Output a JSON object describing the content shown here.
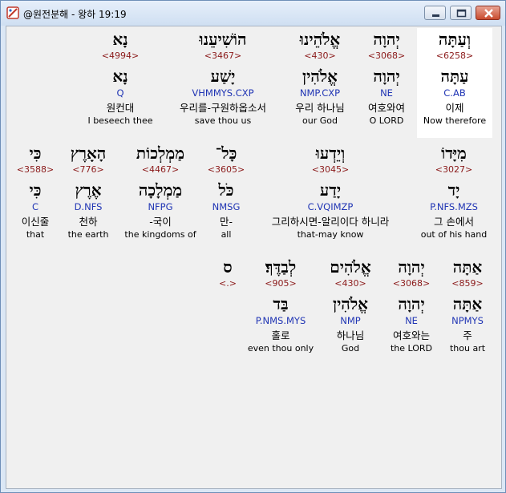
{
  "window": {
    "title": "@원전분해 - 왕하 19:19"
  },
  "rows": [
    [
      {
        "heb": "וְעַתָּה",
        "strong": "<6258>",
        "lemma": "עַתָּה",
        "morph": "C.AB",
        "kor": "이제",
        "eng": "Now therefore"
      },
      {
        "heb": "יְהוָה",
        "strong": "<3068>",
        "lemma": "יְהוָה",
        "morph": "NE",
        "kor": "여호와여",
        "eng": "O LORD"
      },
      {
        "heb": "אֱלֹהֵינוּ",
        "strong": "<430>",
        "lemma": "אֱלֹהִין",
        "morph": "NMP.CXP",
        "kor": "우리 하나님",
        "eng": "our God"
      },
      {
        "heb": "הוֹשִׁיעֵנוּ",
        "strong": "<3467>",
        "lemma": "יָשַׁע",
        "morph": "VHMMYS.CXP",
        "kor": "우리를-구원하옵소서",
        "eng": "save thou us"
      },
      {
        "heb": "נָא",
        "strong": "<4994>",
        "lemma": "נָא",
        "morph": "Q",
        "kor": "원컨대",
        "eng": "I beseech thee"
      }
    ],
    [
      {
        "heb": "מִיָּדוֹ",
        "strong": "<3027>",
        "lemma": "יָד",
        "morph": "P.NFS.MZS",
        "kor": "그 손에서",
        "eng": "out of his hand"
      },
      {
        "heb": "וְיֵדְעוּ",
        "strong": "<3045>",
        "lemma": "יָדַע",
        "morph": "C.VQIMZP",
        "kor": "그리하시면-알리이다 하니라",
        "eng": "that-may know"
      },
      {
        "heb": "כָּל־",
        "strong": "<3605>",
        "lemma": "כֹּל",
        "morph": "NMSG",
        "kor": "만-",
        "eng": "all"
      },
      {
        "heb": "מַמְלְכוֹת",
        "strong": "<4467>",
        "lemma": "מַמְלָכָה",
        "morph": "NFPG",
        "kor": "-국이",
        "eng": "the kingdoms of"
      },
      {
        "heb": "הָאָרֶץ",
        "strong": "<776>",
        "lemma": "אֶרֶץ",
        "morph": "D.NFS",
        "kor": "천하",
        "eng": "the earth"
      },
      {
        "heb": "כִּי",
        "strong": "<3588>",
        "lemma": "כִּי",
        "morph": "C",
        "kor": "이신줄",
        "eng": "that"
      }
    ],
    [
      {
        "heb": "אַתָּה",
        "strong": "<859>",
        "lemma": "אַתָּה",
        "morph": "NPMYS",
        "kor": "주",
        "eng": "thou art"
      },
      {
        "heb": "יְהוָה",
        "strong": "<3068>",
        "lemma": "יְהוָה",
        "morph": "NE",
        "kor": "여호와는",
        "eng": "the LORD"
      },
      {
        "heb": "אֱלֹהִים",
        "strong": "<430>",
        "lemma": "אֱלֹהִין",
        "morph": "NMP",
        "kor": "하나님",
        "eng": "God"
      },
      {
        "heb": "לְבַדֶּךָ׃",
        "strong": "<905>",
        "lemma": "בַּד",
        "morph": "P.NMS.MYS",
        "kor": "홀로",
        "eng": "even thou only"
      },
      {
        "heb": "ס",
        "strong": "<.>",
        "lemma": "",
        "morph": "",
        "kor": "",
        "eng": ""
      }
    ]
  ]
}
